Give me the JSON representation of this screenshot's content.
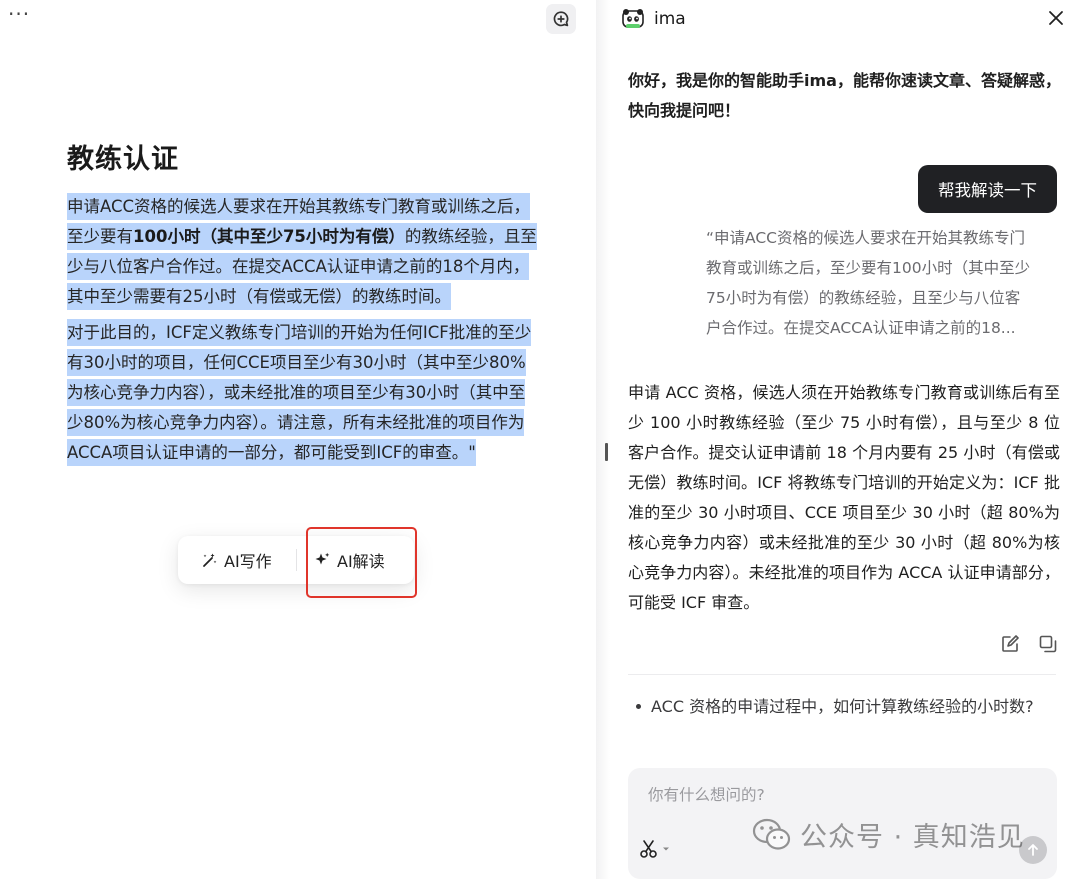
{
  "editor": {
    "more_label": "···",
    "title": "教练认证",
    "para1": {
      "part1": "申请ACC资格的候选人要求在开始其教练专门教育或训练之后，至少要有",
      "bold": "100小时（其中至少75小时为有偿）",
      "part2": "的教练经验，且至少与八位客户合作过。在提交ACCA认证申请之前的18个月内，其中至少需要有25小时（有偿或无偿）的教练时间。"
    },
    "para2": "对于此目的，ICF定义教练专门培训的开始为任何ICF批准的至少有30小时的项目，任何CCE项目至少有30小时（其中至少80%为核心竞争力内容），或未经批准的项目至少有30小时（其中至少80%为核心竞争力内容）。请注意，所有未经批准的项目作为ACCA项目认证申请的一部分，都可能受到ICF的审查。\"",
    "selection_color": "#b9d4fb"
  },
  "ai_toolbar": {
    "write_label": "AI写作",
    "read_label": "AI解读",
    "highlight_color": "#e0352b"
  },
  "chat": {
    "name": "ima",
    "greeting": "你好，我是你的智能助手ima，能帮你速读文章、答疑解惑，快向我提问吧！",
    "user_message": "帮我解读一下",
    "quote_lines": [
      "“申请ACC资格的候选人要求在开始其教练专门",
      "教育或训练之后，至少要有100小时（其中至少",
      "75小时为有偿）的教练经验，且至少与八位客",
      "户合作过。在提交ACCA认证申请之前的18..."
    ],
    "answer": "申请 ACC 资格，候选人须在开始教练专门教育或训练后有至少 100 小时教练经验（至少 75 小时有偿），且与至少 8 位客户合作。提交认证申请前 18 个月内要有 25 小时（有偿或无偿）教练时间。ICF 将教练专门培训的开始定义为：ICF 批准的至少 30 小时项目、CCE 项目至少 30 小时（超 80%为核心竞争力内容）或未经批准的至少 30 小时（超 80%为核心竞争力内容）。未经批准的项目作为 ACCA 认证申请部分，可能受 ICF 审查。",
    "suggestion": "ACC 资格的申请过程中，如何计算教练经验的小时数?",
    "input_placeholder": "你有什么想问的?",
    "bubble_color": "#202124"
  },
  "watermark": {
    "text": "公众号 · 真知浩见"
  }
}
